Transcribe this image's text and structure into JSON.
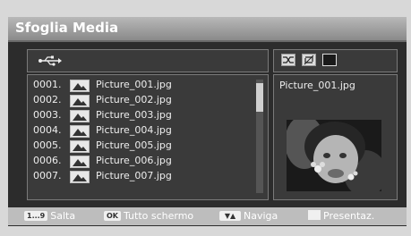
{
  "title": "Sfoglia Media",
  "files": [
    {
      "num": "0001.",
      "name": "Picture_001.jpg"
    },
    {
      "num": "0002.",
      "name": "Picture_002.jpg"
    },
    {
      "num": "0003.",
      "name": "Picture_003.jpg"
    },
    {
      "num": "0004.",
      "name": "Picture_004.jpg"
    },
    {
      "num": "0005.",
      "name": "Picture_005.jpg"
    },
    {
      "num": "0006.",
      "name": "Picture_006.jpg"
    },
    {
      "num": "0007.",
      "name": "Picture_007.jpg"
    }
  ],
  "preview": {
    "filename": "Picture_001.jpg"
  },
  "footer": {
    "jump_key": "1...9",
    "jump_label": "Salta",
    "fullscreen_key": "OK",
    "fullscreen_label": "Tutto schermo",
    "navigate_label": "Naviga",
    "slideshow_label": "Presentaz."
  },
  "icons": {
    "usb": "usb-icon",
    "file": "picture-file-icon",
    "modes": [
      "shuffle-icon",
      "repeat-icon",
      "blank-mode-icon"
    ],
    "nav_key": "up-down-arrows-icon"
  },
  "colors": {
    "background": "#2c2c2c",
    "title_bar": "#a6a6a6",
    "footer": "#bdbdbd"
  }
}
